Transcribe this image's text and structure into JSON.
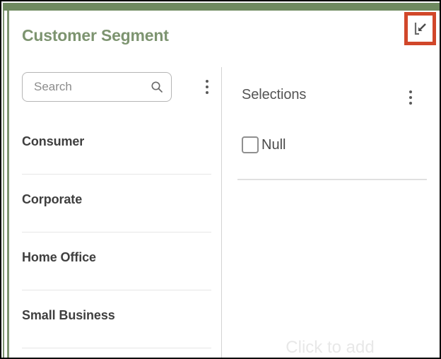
{
  "window": {
    "title": "Customer Segment",
    "accent_color": "#7d9470",
    "highlight_color": "#d1472a"
  },
  "header": {
    "title": "Customer Segment",
    "expand_button": {
      "icon": "expand-into-corner-icon",
      "label": "Expand",
      "highlighted": true
    }
  },
  "left_panel": {
    "search": {
      "value": "",
      "placeholder": "Search",
      "icon": "search-icon"
    },
    "menu_icon": "kebab-menu-icon",
    "items": [
      {
        "label": "Consumer"
      },
      {
        "label": "Corporate"
      },
      {
        "label": "Home Office"
      },
      {
        "label": "Small Business"
      }
    ]
  },
  "right_panel": {
    "title": "Selections",
    "menu_icon": "kebab-menu-icon",
    "options": [
      {
        "label": "Null",
        "checked": false
      }
    ],
    "placeholder_text": "Click to add"
  }
}
